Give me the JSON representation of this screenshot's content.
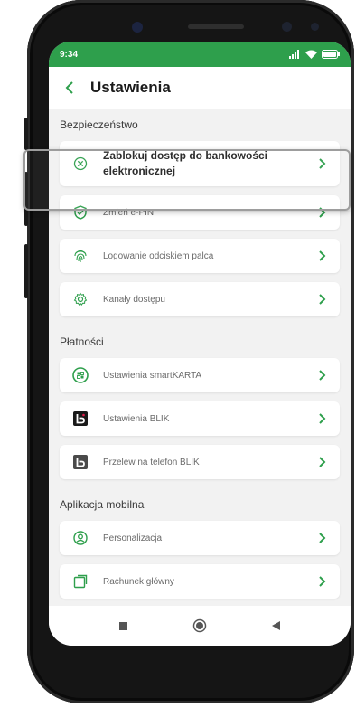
{
  "status": {
    "time": "9:34"
  },
  "header": {
    "title": "Ustawienia"
  },
  "sections": {
    "security": "Bezpieczeństwo",
    "payments": "Płatności",
    "mobile_app": "Aplikacja mobilna"
  },
  "items": {
    "block": "Zablokuj dostęp do bankowości elektronicznej",
    "epin": "Zmień e-PIN",
    "fingerprint": "Logowanie odciskiem palca",
    "channels": "Kanały dostępu",
    "smartkarta": "Ustawienia smartKARTA",
    "blik_settings": "Ustawienia BLIK",
    "blik_transfer": "Przelew na telefon BLIK",
    "personalization": "Personalizacja",
    "main_account": "Rachunek główny"
  },
  "colors": {
    "accent": "#2e9f4c",
    "background": "#f2f2f2",
    "blik": "#1a1a1a"
  },
  "icons": {
    "block": "block-circle-x-icon",
    "epin": "shield-check-icon",
    "fingerprint": "fingerprint-icon",
    "channels": "gear-icon",
    "smartkarta": "smartkarta-icon",
    "blik": "blik-logo-icon",
    "personalization": "user-circle-icon",
    "main_account": "account-icon"
  }
}
